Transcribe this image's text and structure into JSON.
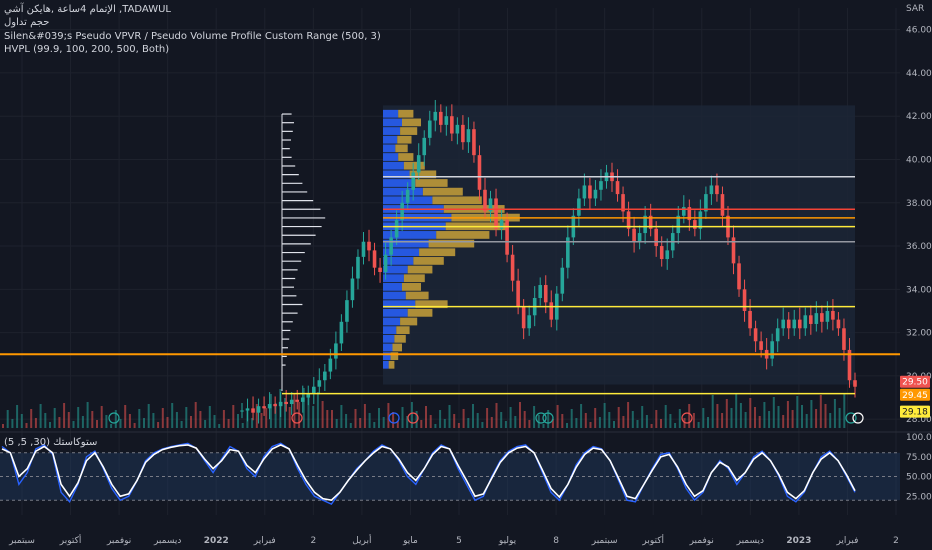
{
  "header": {
    "line1": "الإتمام 4ساعة ,هايكن آشي ,TADAWUL",
    "line2": "حجم تداول",
    "line3": "Silen&#039;s Pseudo VPVR / Pseudo Volume Profile Custom Range (500, 3)",
    "line4": "HVPL (99.9, 100, 200, 500, Both)",
    "currency": "SAR"
  },
  "oscillator": {
    "label": "(5 ,5 ,30) ستوكاستك"
  },
  "colors": {
    "background": "#131722",
    "grid": "#1e222d",
    "up": "#26a69a",
    "down": "#ef5350",
    "vp_blue": "#2962ff",
    "vp_gold": "#c9a13a",
    "level_orange": "#ff9800",
    "level_yellow": "#ffeb3b",
    "level_red": "#f44336",
    "level_white": "#d1d4dc",
    "stoch_k": "#2962ff",
    "stoch_d": "#ffffff"
  },
  "chart_data": [
    {
      "type": "line",
      "title": "",
      "y_ticks": [
        "46.00",
        "44.00",
        "42.00",
        "40.00",
        "38.00",
        "36.00",
        "34.00",
        "32.00",
        "30.00",
        "28.00"
      ],
      "ylim": [
        27.5,
        47.0
      ],
      "x_ticks": [
        "سبتمبر",
        "أكتوبر",
        "نوفمبر",
        "ديسمبر",
        "2022",
        "فبراير",
        "2",
        "أبريل",
        "مايو",
        "5",
        "يوليو",
        "8",
        "سبتمبر",
        "أكتوبر",
        "نوفمبر",
        "ديسمبر",
        "2023",
        "فبراير",
        "2"
      ],
      "price_labels": [
        {
          "value": 29.5,
          "text": "29.50",
          "color": "#ef5350"
        },
        {
          "value": 29.45,
          "text": "29.45",
          "color": "#ff9800"
        },
        {
          "value": 29.18,
          "text": "29.18",
          "color": "#ffeb3b"
        }
      ],
      "series": [
        {
          "values": [
            28.4,
            28.5,
            28.3,
            28.6,
            28.5,
            28.7,
            28.6,
            28.8,
            28.7,
            28.9,
            28.8,
            29.0,
            29.2,
            29.5,
            29.8,
            30.2,
            30.8,
            31.5,
            32.5,
            33.5,
            34.5,
            35.5,
            36.2,
            35.8,
            35.0,
            34.8,
            35.6,
            36.4,
            37.2,
            38.0,
            38.6,
            39.4,
            40.2,
            41.0,
            41.8,
            42.2,
            41.6,
            42.0,
            41.2,
            41.6,
            40.8,
            41.4,
            40.2,
            38.6,
            37.6,
            38.2,
            36.8,
            37.2,
            35.6,
            34.4,
            33.2,
            32.2,
            32.8,
            33.6,
            34.2,
            33.4,
            32.6,
            33.8,
            35.0,
            36.4,
            37.4,
            38.2,
            38.8,
            38.2,
            38.6,
            39.0,
            39.4,
            39.0,
            38.4,
            37.6,
            36.8,
            36.2,
            36.6,
            37.4,
            36.8,
            36.0,
            35.4,
            35.8,
            36.6,
            37.4,
            37.8,
            37.2,
            36.8,
            37.6,
            38.4,
            38.8,
            38.4,
            37.4,
            36.4,
            35.2,
            34.0,
            33.0,
            32.2,
            31.6,
            31.2,
            30.8,
            31.6,
            32.2,
            32.6,
            32.2,
            32.6,
            32.2,
            32.8,
            32.4,
            32.9,
            32.5,
            33.0,
            32.6,
            32.2,
            31.2,
            29.8,
            29.5
          ]
        }
      ],
      "volume_profile_rows": [
        {
          "price": 42.1,
          "vol": 1.6
        },
        {
          "price": 41.7,
          "vol": 2.0
        },
        {
          "price": 41.3,
          "vol": 1.8
        },
        {
          "price": 40.9,
          "vol": 1.5
        },
        {
          "price": 40.5,
          "vol": 1.3
        },
        {
          "price": 40.1,
          "vol": 1.6
        },
        {
          "price": 39.7,
          "vol": 2.2
        },
        {
          "price": 39.3,
          "vol": 2.8
        },
        {
          "price": 38.9,
          "vol": 3.4
        },
        {
          "price": 38.5,
          "vol": 4.2
        },
        {
          "price": 38.1,
          "vol": 5.2
        },
        {
          "price": 37.7,
          "vol": 6.4
        },
        {
          "price": 37.3,
          "vol": 7.2
        },
        {
          "price": 36.9,
          "vol": 6.6
        },
        {
          "price": 36.5,
          "vol": 5.6
        },
        {
          "price": 36.1,
          "vol": 4.8
        },
        {
          "price": 35.7,
          "vol": 3.8
        },
        {
          "price": 35.3,
          "vol": 3.2
        },
        {
          "price": 34.9,
          "vol": 2.6
        },
        {
          "price": 34.5,
          "vol": 2.2
        },
        {
          "price": 34.1,
          "vol": 2.0
        },
        {
          "price": 33.7,
          "vol": 2.4
        },
        {
          "price": 33.3,
          "vol": 3.4
        },
        {
          "price": 32.9,
          "vol": 2.6
        },
        {
          "price": 32.5,
          "vol": 1.8
        },
        {
          "price": 32.1,
          "vol": 1.4
        },
        {
          "price": 31.7,
          "vol": 1.2
        },
        {
          "price": 31.3,
          "vol": 1.0
        },
        {
          "price": 30.9,
          "vol": 0.8
        },
        {
          "price": 30.5,
          "vol": 0.6
        }
      ],
      "levels": [
        {
          "price": 39.2,
          "color": "#d1d4dc"
        },
        {
          "price": 37.7,
          "color": "#f44336"
        },
        {
          "price": 37.3,
          "color": "#ff9800"
        },
        {
          "price": 36.9,
          "color": "#ffeb3b"
        },
        {
          "price": 36.2,
          "color": "#9598a1"
        },
        {
          "price": 33.2,
          "color": "#ffeb3b"
        },
        {
          "price": 31.0,
          "color": "#ff9800"
        },
        {
          "price": 29.18,
          "color": "#ffeb3b"
        }
      ]
    },
    {
      "type": "line",
      "title": "",
      "y_ticks": [
        "100.00",
        "75.00",
        "50.00",
        "25.00"
      ],
      "ylim": [
        0,
        100
      ],
      "bands": [
        80,
        50,
        20
      ],
      "series": [
        {
          "name": "%K",
          "values": [
            88,
            80,
            40,
            55,
            85,
            90,
            78,
            30,
            18,
            40,
            75,
            82,
            60,
            35,
            20,
            25,
            45,
            70,
            80,
            85,
            88,
            90,
            92,
            86,
            70,
            55,
            72,
            88,
            82,
            60,
            50,
            75,
            88,
            92,
            85,
            60,
            40,
            25,
            20,
            15,
            30,
            45,
            60,
            70,
            82,
            90,
            85,
            70,
            50,
            40,
            60,
            80,
            90,
            85,
            60,
            40,
            20,
            25,
            50,
            70,
            82,
            88,
            90,
            80,
            55,
            30,
            20,
            40,
            65,
            80,
            88,
            85,
            70,
            45,
            20,
            18,
            40,
            60,
            78,
            80,
            60,
            35,
            20,
            30,
            55,
            70,
            60,
            40,
            55,
            75,
            82,
            70,
            50,
            25,
            18,
            30,
            55,
            75,
            82,
            70,
            50,
            30
          ]
        },
        {
          "name": "%D",
          "values": [
            85,
            80,
            50,
            60,
            82,
            88,
            80,
            40,
            25,
            42,
            70,
            80,
            62,
            40,
            25,
            28,
            45,
            68,
            78,
            84,
            87,
            89,
            90,
            86,
            72,
            60,
            70,
            84,
            82,
            64,
            55,
            72,
            85,
            90,
            85,
            64,
            45,
            30,
            22,
            20,
            30,
            45,
            58,
            70,
            80,
            88,
            85,
            72,
            55,
            45,
            60,
            78,
            88,
            85,
            64,
            45,
            25,
            28,
            48,
            68,
            80,
            86,
            88,
            80,
            58,
            35,
            24,
            40,
            62,
            78,
            86,
            84,
            70,
            48,
            25,
            22,
            40,
            58,
            75,
            78,
            62,
            40,
            25,
            32,
            55,
            68,
            62,
            45,
            55,
            72,
            80,
            70,
            52,
            30,
            22,
            32,
            55,
            72,
            80,
            70,
            52,
            32
          ]
        }
      ]
    }
  ]
}
